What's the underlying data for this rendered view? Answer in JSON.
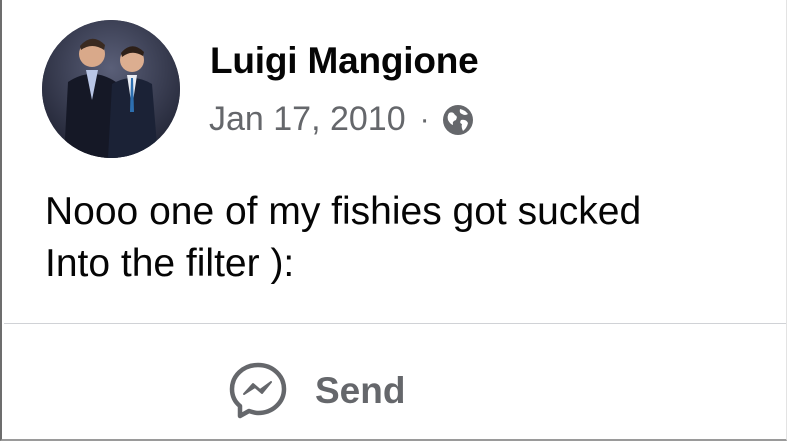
{
  "post": {
    "author": "Luigi Mangione",
    "date": "Jan 17, 2010",
    "separator": "·",
    "audience_icon": "globe-icon",
    "text": "Nooo one of my fishies got sucked\nInto the filter ):"
  },
  "actions": {
    "send_label": "Send",
    "send_icon": "messenger-icon"
  },
  "colors": {
    "primary_text": "#050505",
    "secondary_text": "#65676b",
    "divider": "#d0d2d6"
  }
}
